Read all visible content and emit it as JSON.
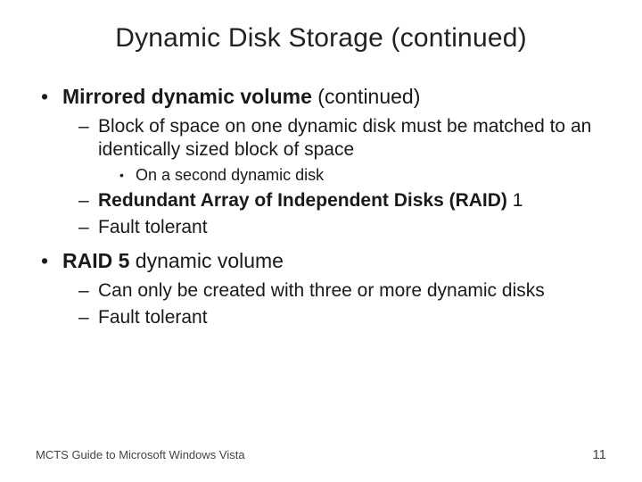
{
  "title": "Dynamic Disk Storage (continued)",
  "bullets": {
    "b1": {
      "bold": "Mirrored dynamic volume",
      "rest": " (continued)",
      "sub1": "Block of space on one dynamic disk must be matched to an identically sized block of space",
      "sub1a": "On a second dynamic disk",
      "sub2_bold": "Redundant Array of Independent Disks (RAID)",
      "sub2_rest": " 1",
      "sub3": "Fault tolerant"
    },
    "b2": {
      "bold": "RAID 5",
      "rest": " dynamic volume",
      "sub1": "Can only be created with three or more dynamic disks",
      "sub2": "Fault tolerant"
    }
  },
  "footer": {
    "text": "MCTS Guide to Microsoft Windows Vista",
    "page": "11"
  }
}
